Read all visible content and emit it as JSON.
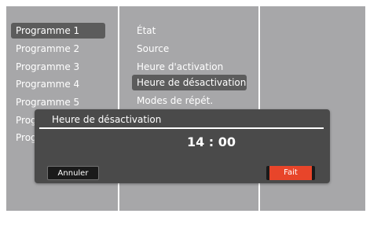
{
  "programs": [
    "Programme 1",
    "Programme 2",
    "Programme 3",
    "Programme 4",
    "Programme 5",
    "Prog",
    "Prog"
  ],
  "settings": [
    "État",
    "Source",
    "Heure d'activation",
    "Heure de désactivation",
    "Modes de répét."
  ],
  "dialog": {
    "title": "Heure de désactivation",
    "time": "14 : 00",
    "cancel_label": "Annuler",
    "done_label": "Fait"
  },
  "colors": {
    "panel": "#a7a7a9",
    "selection": "#5c5c5c",
    "dialog": "#4a4a4a",
    "accent": "#e8452a"
  }
}
